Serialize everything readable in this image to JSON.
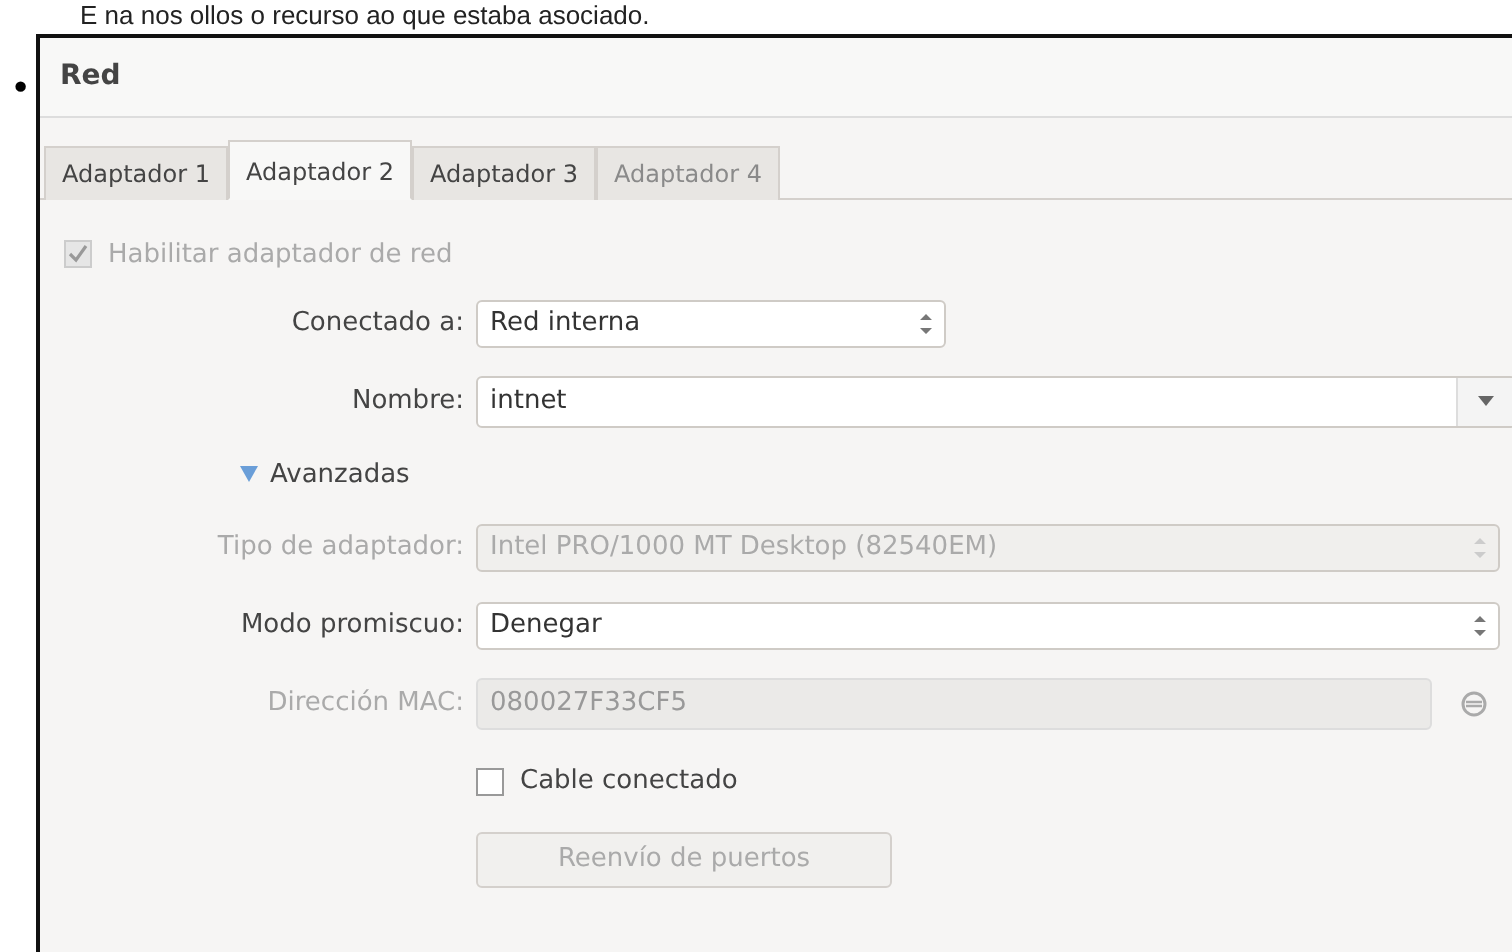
{
  "caption": "E na nos ollos o recurso ao que estaba asociado.",
  "bullet": "•",
  "dialog": {
    "title": "Red",
    "tabs": [
      {
        "label": "Adaptador 1",
        "selected": false,
        "disabled": false
      },
      {
        "label": "Adaptador 2",
        "selected": true,
        "disabled": false
      },
      {
        "label": "Adaptador 3",
        "selected": false,
        "disabled": false
      },
      {
        "label": "Adaptador 4",
        "selected": false,
        "disabled": true
      }
    ],
    "enable": {
      "label": "Habilitar adaptador de red",
      "checked": true,
      "disabled": true
    },
    "rows": [
      {
        "kind": "combo",
        "label": "Conectado a:",
        "value": "Red interna",
        "disabled": false,
        "wide": false
      },
      {
        "kind": "editcombo",
        "label": "Nombre:",
        "value": "intnet"
      },
      {
        "kind": "expander",
        "label": "Avanzadas",
        "expanded": true
      },
      {
        "kind": "combo",
        "label": "Tipo de adaptador:",
        "value": "Intel PRO/1000 MT Desktop (82540EM)",
        "disabled": true,
        "wide": true
      },
      {
        "kind": "combo",
        "label": "Modo promiscuo:",
        "value": "Denegar",
        "disabled": false,
        "wide": true
      },
      {
        "kind": "text",
        "label": "Dirección MAC:",
        "value": "080027F33CF5",
        "disabled": true
      },
      {
        "kind": "check",
        "label": "Cable conectado",
        "checked": false,
        "disabled": false
      },
      {
        "kind": "button",
        "label": "Reenvío de puertos",
        "disabled": true
      }
    ]
  }
}
